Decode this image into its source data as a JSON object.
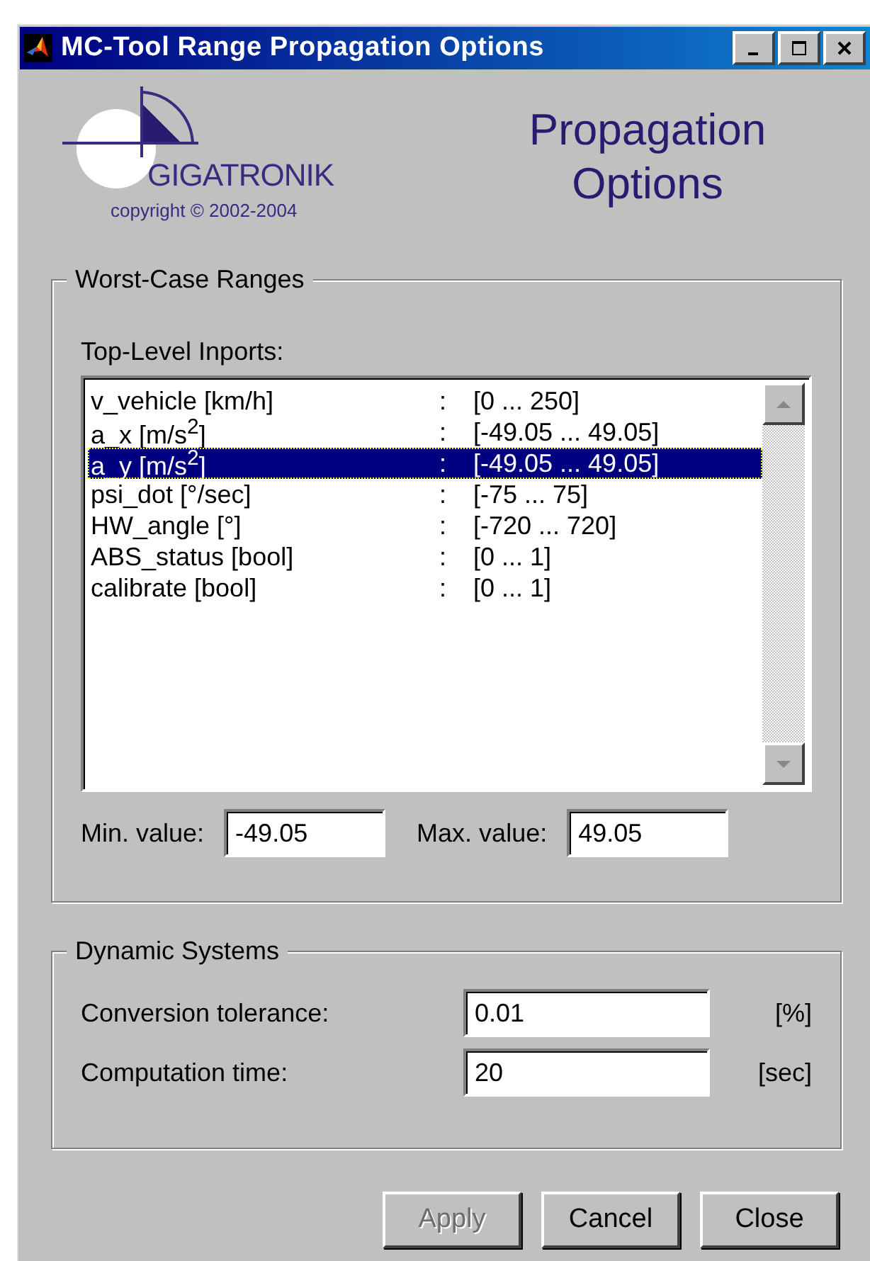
{
  "window": {
    "title": "MC-Tool Range Propagation Options"
  },
  "logo": {
    "name": "GIGATRONIK",
    "copyright": "copyright © 2002-2004"
  },
  "heading": "Propagation Options",
  "worst_case": {
    "title": "Worst-Case Ranges",
    "list_label": "Top-Level Inports:",
    "inports": [
      {
        "name": "v_vehicle [km/h]",
        "separator": ":",
        "range": "[0 ... 250]",
        "selected": false
      },
      {
        "name": "a_x [m/s$^{2}$]",
        "separator": ":",
        "range": "[-49.05 ... 49.05]",
        "selected": false
      },
      {
        "name": "a_y [m/s$^{2}$]",
        "separator": ":",
        "range": "[-49.05 ... 49.05]",
        "selected": true
      },
      {
        "name": "psi_dot [°/sec]",
        "separator": ":",
        "range": "[-75 ... 75]",
        "selected": false
      },
      {
        "name": "HW_angle [°]",
        "separator": ":",
        "range": "[-720 ... 720]",
        "selected": false
      },
      {
        "name": "ABS_status [bool]",
        "separator": ":",
        "range": "[0 ... 1]",
        "selected": false
      },
      {
        "name": "calibrate [bool]",
        "separator": ":",
        "range": "[0 ... 1]",
        "selected": false
      }
    ],
    "min": {
      "label": "Min. value:",
      "value": "-49.05"
    },
    "max": {
      "label": "Max. value:",
      "value": "49.05"
    }
  },
  "dynamic": {
    "title": "Dynamic Systems",
    "fields": [
      {
        "label": "Conversion tolerance:",
        "value": "0.01",
        "unit": "[%]"
      },
      {
        "label": "Computation time:",
        "value": "20",
        "unit": "[sec]"
      }
    ]
  },
  "buttons": [
    {
      "label": "Apply",
      "disabled": true
    },
    {
      "label": "Cancel",
      "disabled": false
    },
    {
      "label": "Close",
      "disabled": false
    }
  ]
}
